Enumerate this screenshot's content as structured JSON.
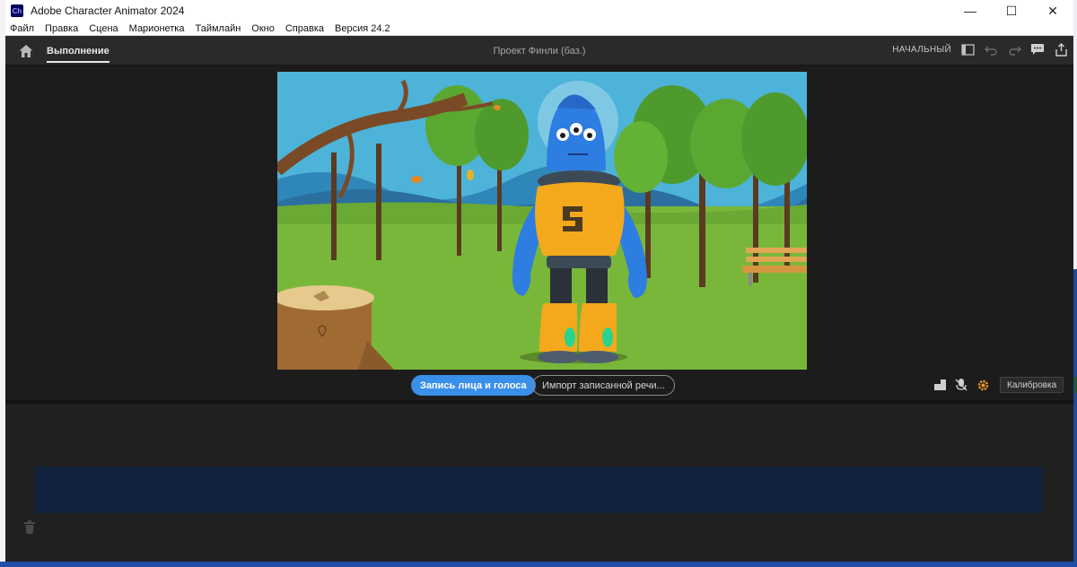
{
  "window": {
    "app_logo": "Ch",
    "title": "Adobe Character Animator 2024",
    "controls": {
      "minimize": "—",
      "maximize": "☐",
      "close": "✕"
    }
  },
  "menu": [
    "Файл",
    "Правка",
    "Сцена",
    "Марионетка",
    "Таймлайн",
    "Окно",
    "Справка",
    "Версия 24.2"
  ],
  "header": {
    "home_icon": "home-icon",
    "tab": "Выполнение",
    "project_title": "Проект Финли (баз.)",
    "workspace_label": "НАЧАЛЬНЫЙ",
    "icons": [
      "panel-toggle-icon",
      "undo-icon",
      "redo-icon",
      "feedback-icon",
      "share-icon"
    ]
  },
  "scene": {
    "sky_color": "#4db3d8",
    "grass_color": "#79b73a",
    "robot_body_color": "#f4a81c",
    "character_color": "#2e7de0"
  },
  "controls": {
    "record_button": "Запись лица и голоса",
    "import_button": "Импорт записанной речи...",
    "calibrate_button": "Калибровка",
    "accent_color": "#3a8fe8"
  },
  "timeline": {
    "track_color": "#12223f",
    "trash_icon": "trash-icon"
  }
}
